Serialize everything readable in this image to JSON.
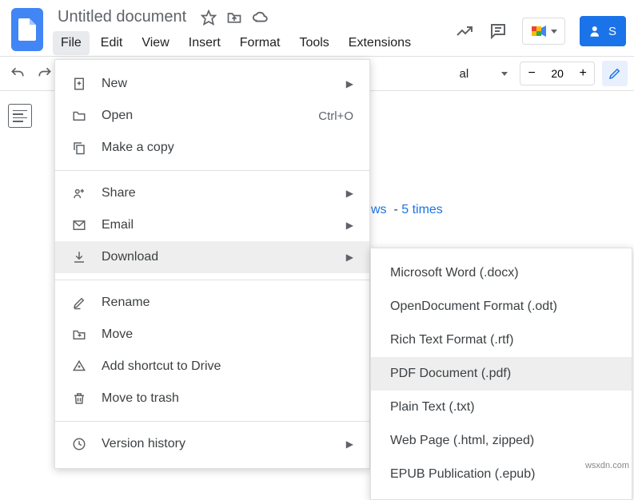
{
  "doc": {
    "title": "Untitled document"
  },
  "menubar": [
    "File",
    "Edit",
    "View",
    "Insert",
    "Format",
    "Tools",
    "Extensions"
  ],
  "toolbar": {
    "font": "al",
    "zoom": "20"
  },
  "share": {
    "label": "S"
  },
  "file_menu": {
    "new": "New",
    "open": "Open",
    "open_shortcut": "Ctrl+O",
    "copy": "Make a copy",
    "share": "Share",
    "email": "Email",
    "download": "Download",
    "rename": "Rename",
    "move": "Move",
    "shortcut": "Add shortcut to Drive",
    "trash": "Move to trash",
    "history": "Version history"
  },
  "download_menu": [
    "Microsoft Word (.docx)",
    "OpenDocument Format (.odt)",
    "Rich Text Format (.rtf)",
    "PDF Document (.pdf)",
    "Plain Text (.txt)",
    "Web Page (.html, zipped)",
    "EPUB Publication (.epub)"
  ],
  "doc_body": {
    "link1": "ws",
    "dash": "-",
    "link2": "5 times"
  },
  "watermark": "wsxdn.com"
}
